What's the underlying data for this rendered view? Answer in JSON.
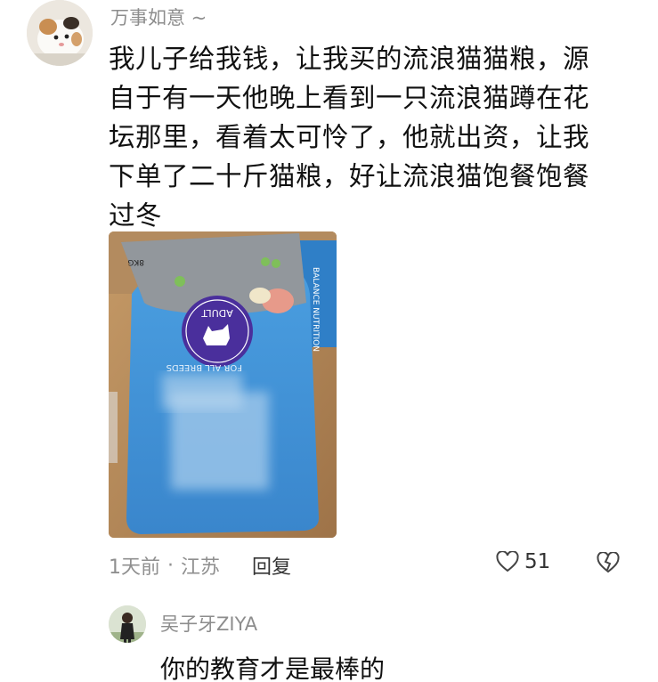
{
  "comment": {
    "username": "万事如意 ~",
    "lines": [
      "我儿子给我钱，让我买的流浪猫猫粮，源",
      "自于有一天他晚上看到一只流浪猫蹲在花",
      "坛那里，看着太可怜了，他就出资，让我",
      "下单了二十斤猫粮，好让流浪猫饱餐饱餐",
      "过冬"
    ],
    "photo": {
      "bag_label_top": "ADULT",
      "bag_text_side": "BALANCE NUTRITION",
      "bag_text_front": "FOR ALL BREEDS",
      "bag_weight": "8KG"
    },
    "time": "1天前",
    "separator": "·",
    "location": "江苏",
    "reply_label": "回复",
    "likes": "51",
    "icons": {
      "like": "heart-icon",
      "dislike": "broken-heart-icon"
    }
  },
  "reply": {
    "username": "吴子牙ZIYA",
    "text": "你的教育才是最棒的"
  },
  "colors": {
    "meta_gray": "#8f8f8f",
    "bag_blue": "#3e8fd3",
    "label_purple": "#4a2f9c"
  }
}
